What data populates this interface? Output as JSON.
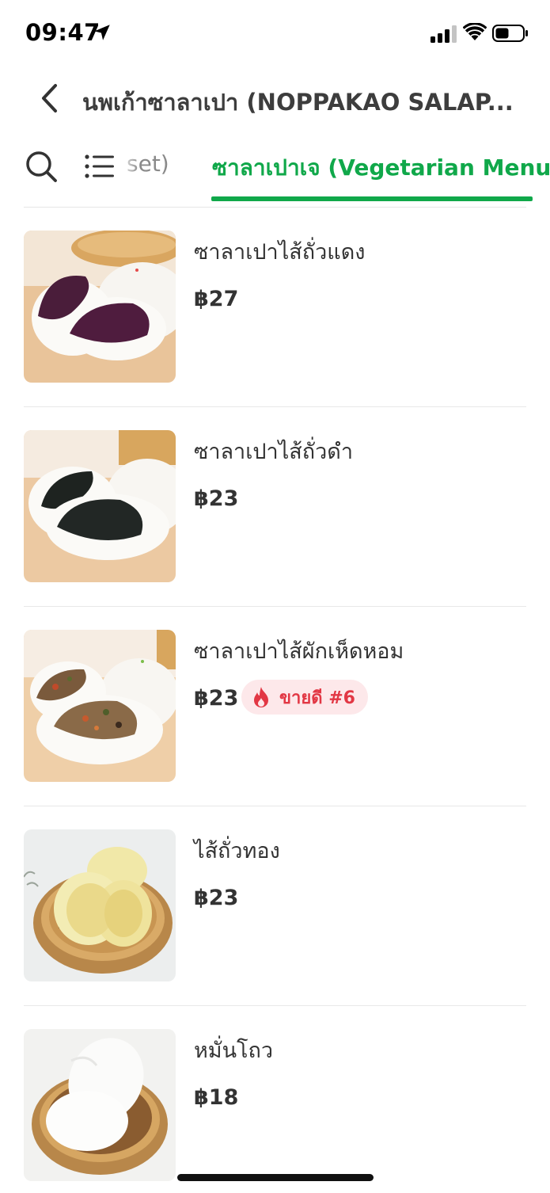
{
  "status_bar": {
    "time": "09:47",
    "icons": [
      "location-arrow-icon",
      "cellular-signal-icon",
      "wifi-icon",
      "battery-icon"
    ]
  },
  "header": {
    "title": "นพเก้าซาลาเปา (NOPPAKAO SALAP...",
    "back_icon": "chevron-left-icon"
  },
  "tabs": {
    "search_icon": "search-icon",
    "list_icon": "list-icon",
    "previous_tab_fragment": "set)",
    "active_tab": "ซาลาเปาเจ (Vegetarian Menu)",
    "accent_color": "#10a84a"
  },
  "menu_items": [
    {
      "name": "ซาลาเปาไส้ถั่วแดง",
      "price": "฿27"
    },
    {
      "name": "ซาลาเปาไส้ถั่วดำ",
      "price": "฿23"
    },
    {
      "name": "ซาลาเปาไส้ผักเห็ดหอม",
      "price": "฿23",
      "badge": "ขายดี #6",
      "badge_icon": "fire-icon",
      "badge_color": "#e23744"
    },
    {
      "name": "ไส้ถั่วทอง",
      "price": "฿23"
    },
    {
      "name": "หมั่นโถว",
      "price": "฿18"
    }
  ]
}
